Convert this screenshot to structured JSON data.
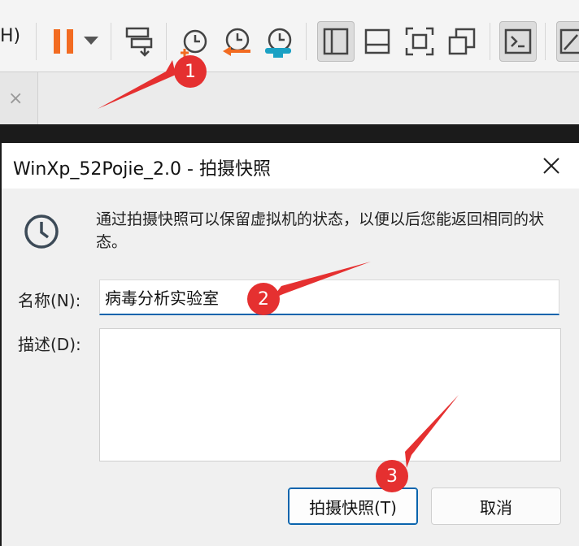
{
  "toolbar": {
    "menu_fragment": "H)",
    "colors": {
      "pause": "#f26b21",
      "arrow_orange": "#f26b21",
      "arrow_cyan": "#1ba1c4"
    },
    "icons": [
      "pause-icon",
      "dropdown-icon",
      "send-keys-icon",
      "take-snapshot-icon",
      "revert-snapshot-icon",
      "snapshot-manager-icon",
      "library-view-icon",
      "thumbnail-view-icon",
      "fullscreen-icon",
      "unity-icon",
      "console-icon",
      "stretch-icon"
    ]
  },
  "tab": {
    "close_glyph": "×"
  },
  "dialog": {
    "title": "WinXp_52Pojie_2.0 - 拍摄快照",
    "info_text": "通过拍摄快照可以保留虚拟机的状态，以便以后您能返回相同的状态。",
    "name_label": "名称(N):",
    "name_value": "病毒分析实验室",
    "desc_label": "描述(D):",
    "desc_value": "",
    "ok_button": "拍摄快照(T)",
    "cancel_button": "取消"
  },
  "annotations": {
    "badges": [
      "1",
      "2",
      "3"
    ],
    "color": "#e53030"
  }
}
